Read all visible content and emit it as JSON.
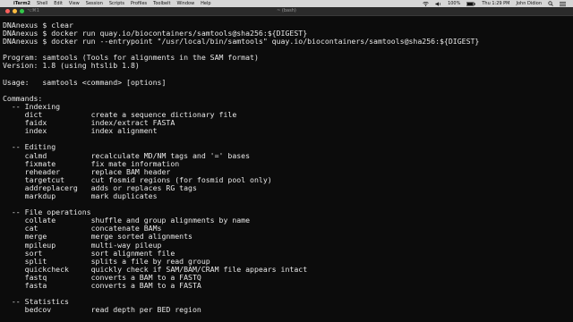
{
  "menubar": {
    "apple": "",
    "items": [
      "iTerm2",
      "Shell",
      "Edit",
      "View",
      "Session",
      "Scripts",
      "Profiles",
      "Toolbelt",
      "Window",
      "Help"
    ],
    "battery": "100%",
    "clock": "Thu 1:29 PM",
    "user": "John Didion"
  },
  "window": {
    "tab_indicator": "⌥⌘1",
    "title": "~ (bash)"
  },
  "terminal": {
    "lines": [
      "DNAnexus $ clear",
      "DNAnexus $ docker run quay.io/biocontainers/samtools@sha256:${DIGEST}",
      "DNAnexus $ docker run --entrypoint \"/usr/local/bin/samtools\" quay.io/biocontainers/samtools@sha256:${DIGEST}",
      "",
      "Program: samtools (Tools for alignments in the SAM format)",
      "Version: 1.8 (using htslib 1.8)",
      "",
      "Usage:   samtools <command> [options]",
      "",
      "Commands:",
      "  -- Indexing",
      "     dict           create a sequence dictionary file",
      "     faidx          index/extract FASTA",
      "     index          index alignment",
      "",
      "  -- Editing",
      "     calmd          recalculate MD/NM tags and '=' bases",
      "     fixmate        fix mate information",
      "     reheader       replace BAM header",
      "     targetcut      cut fosmid regions (for fosmid pool only)",
      "     addreplacerg   adds or replaces RG tags",
      "     markdup        mark duplicates",
      "",
      "  -- File operations",
      "     collate        shuffle and group alignments by name",
      "     cat            concatenate BAMs",
      "     merge          merge sorted alignments",
      "     mpileup        multi-way pileup",
      "     sort           sort alignment file",
      "     split          splits a file by read group",
      "     quickcheck     quickly check if SAM/BAM/CRAM file appears intact",
      "     fastq          converts a BAM to a FASTQ",
      "     fasta          converts a BAM to a FASTA",
      "",
      "  -- Statistics",
      "     bedcov         read depth per BED region"
    ]
  }
}
